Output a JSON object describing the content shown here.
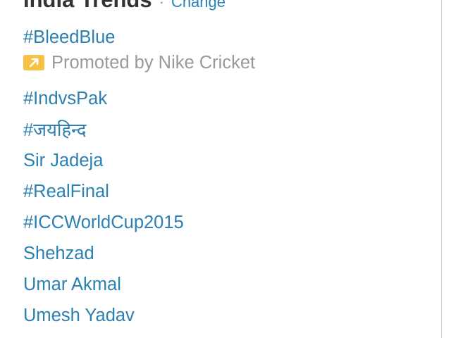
{
  "header": {
    "title": "India Trends",
    "separator": "·",
    "change_label": "Change"
  },
  "promoted": {
    "trend": "#BleedBlue",
    "label": "Promoted by Nike Cricket",
    "icon": "promoted-arrow-icon",
    "icon_color": "#f5c243"
  },
  "trends": [
    {
      "label": "#IndvsPak"
    },
    {
      "label": "#जयहिन्द"
    },
    {
      "label": "Sir Jadeja"
    },
    {
      "label": "#RealFinal"
    },
    {
      "label": "#ICCWorldCup2015"
    },
    {
      "label": "Shehzad"
    },
    {
      "label": "Umar Akmal"
    },
    {
      "label": "Umesh Yadav"
    }
  ],
  "colors": {
    "link": "#2b80b0",
    "muted": "#999999"
  }
}
